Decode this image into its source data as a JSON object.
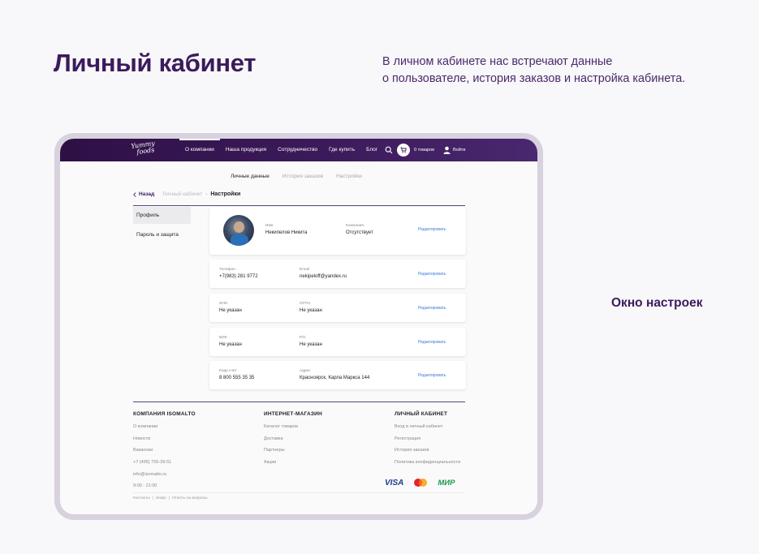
{
  "heading": {
    "title": "Личный кабинет",
    "intro_line1": "В личном кабинете нас встречают  данные",
    "intro_line2": "о пользователе, история заказов и настройка кабинета.",
    "side_caption": "Окно настроек"
  },
  "colors": {
    "brand": "#3b1b5c",
    "link": "#3b7bd5",
    "nav_bg": "#2e1045"
  },
  "navbar": {
    "logo_line1": "Yummy",
    "logo_line2": "foods",
    "items": [
      "О компании",
      "Наша продукция",
      "Сотрудничество",
      "Где купить",
      "Блог"
    ],
    "active_index": 0,
    "cart_label": "0 товаров",
    "login_label": "Войти",
    "icons": {
      "search": "search-icon",
      "cart": "cart-icon",
      "user": "user-icon"
    }
  },
  "tabs": [
    "Личные данные",
    "История заказов",
    "Настройки"
  ],
  "breadcrumb": {
    "back": "Назад",
    "middle": "Личный кабинет",
    "separator": "›",
    "current": "Настройки"
  },
  "side_menu": [
    "Профиль",
    "Пароль и защита"
  ],
  "profile": {
    "name_label": "Имя",
    "name_value": "Некипелов Никита",
    "company_label": "Компания",
    "company_value": "Отсутствует",
    "edit": "Редактировать"
  },
  "field_cards": [
    {
      "l1": "Телефон",
      "v1": "+7(983) 281 9772",
      "l2": "Email",
      "v2": "nekipeloff@yandex.ru",
      "edit": "Редактировать"
    },
    {
      "l1": "ИНН",
      "v1": "Не указан",
      "l2": "ОГРН",
      "v2": "Не указан",
      "edit": "Редактировать"
    },
    {
      "l1": "БИК",
      "v1": "Не указан",
      "l2": "Р/С",
      "v2": "Не указан",
      "edit": "Редактировать"
    },
    {
      "l1": "Корр.счет",
      "v1": "8 800 555 35 35",
      "l2": "Адрес",
      "v2": "Красноярск, Карла Маркса 144",
      "edit": "Редактировать"
    }
  ],
  "footer": {
    "columns": [
      {
        "title": "КОМПАНИЯ ISOMALTO",
        "links": [
          "О компании",
          "Новости",
          "Вакансии",
          "+7 (495) 755-39-51",
          "info@isomalto.ru",
          "9:00 - 21:00"
        ]
      },
      {
        "title": "ИНТЕРНЕТ-МАГАЗИН",
        "links": [
          "Каталог товаров",
          "Доставка",
          "Партнеры",
          "Акции"
        ]
      },
      {
        "title": "ЛИЧНЫЙ КАБИНЕТ",
        "links": [
          "Вход в личный кабинет",
          "Регистрация",
          "История заказов",
          "Политика конфиденциальности"
        ]
      }
    ],
    "payments": {
      "visa": "VISA",
      "mir": "МИР"
    },
    "bottom_links": [
      "Контакты",
      "|",
      "Инфо",
      "|",
      "Ответы на вопросы"
    ]
  }
}
